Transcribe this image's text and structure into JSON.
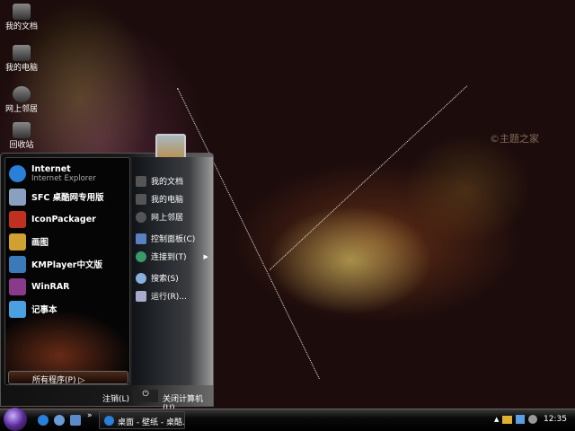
{
  "desktop": {
    "icons": [
      {
        "label": "我的文档",
        "icon": "documents-icon"
      },
      {
        "label": "我的电脑",
        "icon": "computer-icon"
      },
      {
        "label": "网上邻居",
        "icon": "network-icon"
      },
      {
        "label": "回收站",
        "icon": "recycle-bin-icon"
      }
    ],
    "watermark": "©主题之家"
  },
  "start_menu": {
    "pinned": [
      {
        "title": "Internet",
        "subtitle": "Internet Explorer",
        "icon": "ie-icon",
        "color": "#2a7fd8"
      },
      {
        "title": "SFC 桌酷网专用版",
        "icon": "sfc-icon",
        "color": "#8aa0c0"
      },
      {
        "title": "IconPackager",
        "icon": "iconpackager-icon",
        "color": "#c03020"
      },
      {
        "title": "画图",
        "icon": "paint-icon",
        "color": "#d0a030"
      },
      {
        "title": "KMPlayer中文版",
        "icon": "kmplayer-icon",
        "color": "#3a7ab8"
      },
      {
        "title": "WinRAR",
        "icon": "winrar-icon",
        "color": "#8a3a8a"
      },
      {
        "title": "记事本",
        "icon": "notepad-icon",
        "color": "#4aa0e0"
      }
    ],
    "all_programs": "所有程序(P)",
    "right": [
      {
        "label": "我的文档",
        "icon": "documents-icon"
      },
      {
        "label": "我的电脑",
        "icon": "computer-icon"
      },
      {
        "label": "网上邻居",
        "icon": "network-icon"
      },
      {
        "label": "控制面板(C)",
        "icon": "control-panel-icon"
      },
      {
        "label": "连接到(T)",
        "icon": "connect-icon"
      },
      {
        "label": "搜索(S)",
        "icon": "search-icon"
      },
      {
        "label": "运行(R)...",
        "icon": "run-icon"
      }
    ],
    "logoff": "注销(L)",
    "shutdown": "关闭计算机(U)"
  },
  "taskbar": {
    "task": "桌面 - 壁纸 - 桌酷...",
    "clock": "12:35",
    "more": "»"
  }
}
